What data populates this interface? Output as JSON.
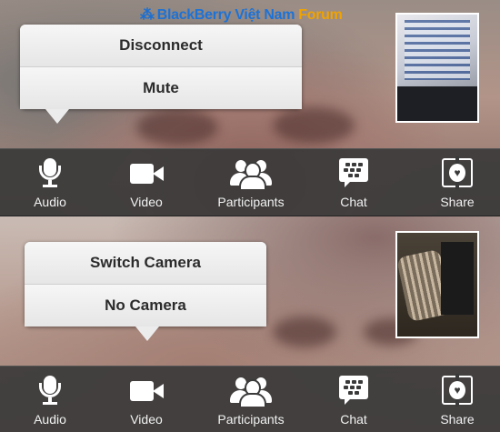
{
  "watermark": {
    "logo_glyph": "⁂",
    "main": "BlackBerry Việt Nam",
    "accent": "Forum"
  },
  "panels": [
    {
      "popup": {
        "items": [
          "Disconnect",
          "Mute"
        ],
        "anchor": "Audio"
      },
      "toolbar": [
        "Audio",
        "Video",
        "Participants",
        "Chat",
        "Share"
      ]
    },
    {
      "popup": {
        "items": [
          "Switch Camera",
          "No Camera"
        ],
        "anchor": "Video"
      },
      "toolbar": [
        "Audio",
        "Video",
        "Participants",
        "Chat",
        "Share"
      ]
    }
  ],
  "icons": [
    "microphone-icon",
    "video-camera-icon",
    "participants-icon",
    "bbm-chat-icon",
    "share-icon"
  ],
  "colors": {
    "toolbar_bg": "#3a3a3a",
    "popup_bg": "#ececec",
    "watermark_blue": "#1d72d6",
    "watermark_orange": "#f0a300"
  }
}
